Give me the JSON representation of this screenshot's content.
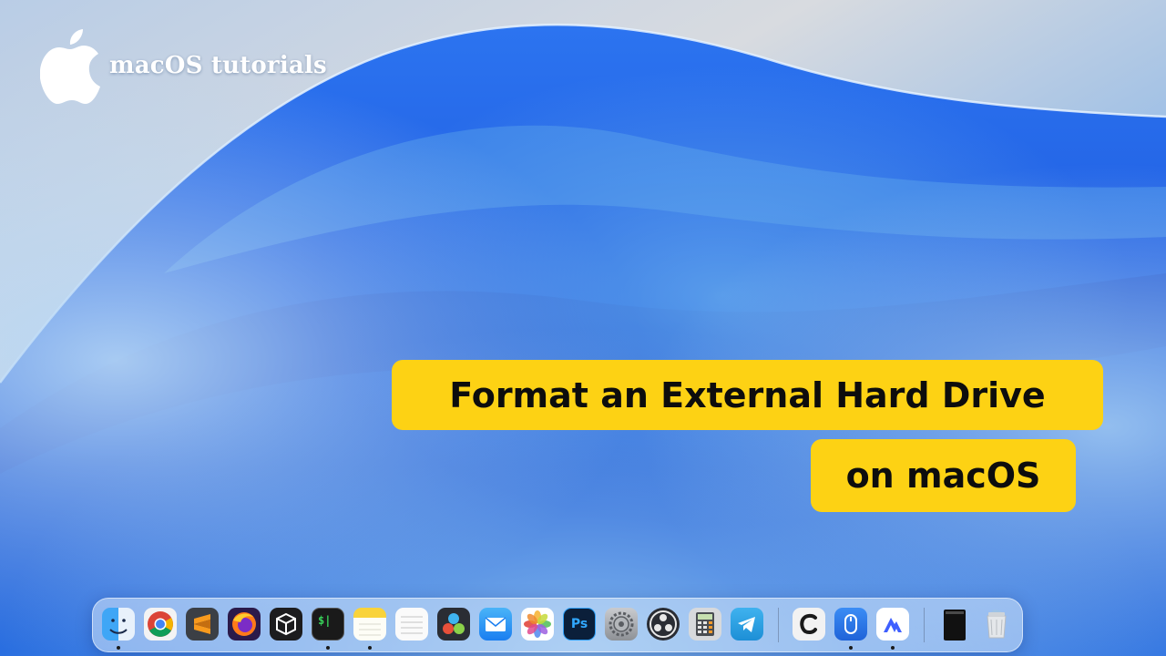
{
  "brand": {
    "name": "macOS tutorials",
    "logo_icon": "apple-logo-icon"
  },
  "title": {
    "line1": "Format an External Hard Drive",
    "line2": "on macOS"
  },
  "colors": {
    "title_bg": "#fdd214",
    "title_text": "#0d0d0d",
    "wallpaper_blue": "#1f5fe0",
    "wallpaper_sky": "#a9c4e4"
  },
  "dock": {
    "apps": [
      {
        "name": "Finder",
        "icon": "finder-icon",
        "running": true
      },
      {
        "name": "Google Chrome",
        "icon": "chrome-icon",
        "running": false
      },
      {
        "name": "Sublime Text",
        "icon": "sublime-text-icon",
        "running": false
      },
      {
        "name": "Firefox",
        "icon": "firefox-icon",
        "running": false
      },
      {
        "name": "Canvas",
        "icon": "cube-app-icon",
        "running": false
      },
      {
        "name": "Terminal",
        "icon": "terminal-icon",
        "running": true
      },
      {
        "name": "Notes",
        "icon": "notes-icon",
        "running": true
      },
      {
        "name": "Reminders",
        "icon": "list-app-icon",
        "running": false
      },
      {
        "name": "DaVinci Resolve",
        "icon": "davinci-resolve-icon",
        "running": false
      },
      {
        "name": "Mail",
        "icon": "mail-icon",
        "running": false
      },
      {
        "name": "Photos",
        "icon": "photos-icon",
        "running": false
      },
      {
        "name": "Photoshop",
        "icon": "photoshop-icon",
        "running": false
      },
      {
        "name": "System Settings",
        "icon": "settings-gear-icon",
        "running": false
      },
      {
        "name": "OBS",
        "icon": "obs-icon",
        "running": false
      },
      {
        "name": "Calculator",
        "icon": "calculator-icon",
        "running": false
      },
      {
        "name": "Telegram",
        "icon": "telegram-icon",
        "running": false
      },
      {
        "name": "CleanShot",
        "icon": "cleanshot-icon",
        "running": false
      },
      {
        "name": "Mouse Utility",
        "icon": "mouse-app-icon",
        "running": true
      },
      {
        "name": "NordVPN",
        "icon": "nordvpn-icon",
        "running": true
      },
      {
        "name": "Downloads Stack",
        "icon": "stack-folder-icon",
        "running": false
      },
      {
        "name": "Trash",
        "icon": "trash-icon",
        "running": false
      }
    ],
    "terminal_glyph": "$|",
    "photoshop_glyph": "Ps"
  }
}
